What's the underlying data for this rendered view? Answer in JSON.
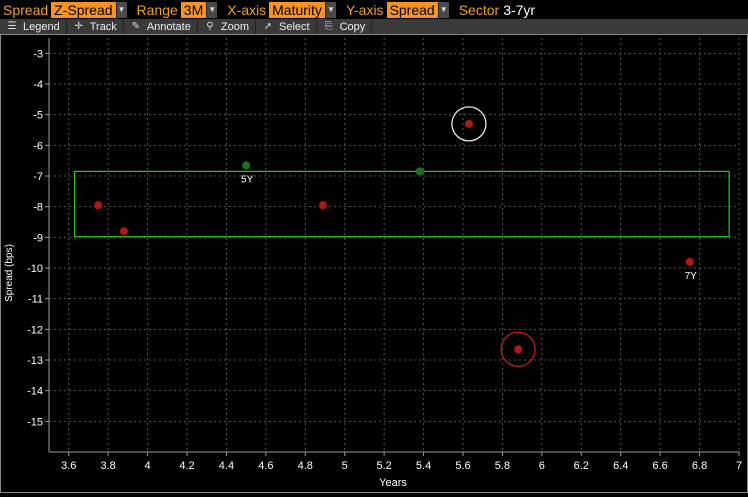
{
  "toolbar_params": {
    "spread_label": "Spread",
    "spread_value": "Z-Spread",
    "range_label": "Range",
    "range_value": "3M",
    "xaxis_label": "X-axis",
    "xaxis_value": "Maturity",
    "yaxis_label": "Y-axis",
    "yaxis_value": "Spread",
    "sector_label": "Sector",
    "sector_value": "3-7yr"
  },
  "tools": [
    {
      "label": "Legend",
      "icon": "legend-icon"
    },
    {
      "label": "Track",
      "icon": "crosshair-icon"
    },
    {
      "label": "Annotate",
      "icon": "pencil-icon"
    },
    {
      "label": "Zoom",
      "icon": "magnifier-icon"
    },
    {
      "label": "Select",
      "icon": "cursor-icon"
    },
    {
      "label": "Copy",
      "icon": "copy-icon"
    }
  ],
  "colors": {
    "accent": "#f7941d",
    "grid": "#555555",
    "point_red": "#b01818",
    "point_green": "#1c6e1c",
    "rect": "#22cc22"
  },
  "chart_data": {
    "type": "scatter",
    "xlabel": "Years",
    "ylabel": "Spread (bps)",
    "xlim": [
      3.5,
      7.0
    ],
    "ylim": [
      -16,
      -2.5
    ],
    "xticks": [
      3.6,
      3.8,
      4,
      4.2,
      4.4,
      4.6,
      4.8,
      5,
      5.2,
      5.4,
      5.6,
      5.8,
      6,
      6.2,
      6.4,
      6.6,
      6.8,
      7
    ],
    "xtick_labels": [
      "3.6",
      "3.8",
      "4",
      "4.2",
      "4.4",
      "4.6",
      "4.8",
      "5",
      "5.2",
      "5.4",
      "5.6",
      "5.8",
      "6",
      "6.2",
      "6.4",
      "6.6",
      "6.8",
      "7"
    ],
    "yticks": [
      -3,
      -4,
      -5,
      -6,
      -7,
      -8,
      -9,
      -10,
      -11,
      -12,
      -13,
      -14,
      -15
    ],
    "ytick_labels": [
      "-3",
      "-4",
      "-5",
      "-6",
      "-7",
      "-8",
      "-9",
      "-10",
      "-11",
      "-12",
      "-13",
      "-14",
      "-15"
    ],
    "grid": true,
    "points": [
      {
        "x": 3.75,
        "y": -7.95,
        "color": "red",
        "label": ""
      },
      {
        "x": 3.88,
        "y": -8.8,
        "color": "red",
        "label": ""
      },
      {
        "x": 4.5,
        "y": -6.65,
        "color": "green",
        "label": "5Y"
      },
      {
        "x": 4.89,
        "y": -7.95,
        "color": "red",
        "label": ""
      },
      {
        "x": 5.38,
        "y": -6.85,
        "color": "green",
        "label": ""
      },
      {
        "x": 5.63,
        "y": -5.3,
        "color": "red",
        "label": "",
        "ring": "white"
      },
      {
        "x": 5.88,
        "y": -12.65,
        "color": "red",
        "label": "",
        "ring": "red"
      },
      {
        "x": 6.75,
        "y": -9.8,
        "color": "red",
        "label": "7Y"
      }
    ],
    "highlight_range": {
      "x": [
        3.63,
        6.95
      ],
      "y": [
        -6.85,
        -8.98
      ]
    }
  }
}
